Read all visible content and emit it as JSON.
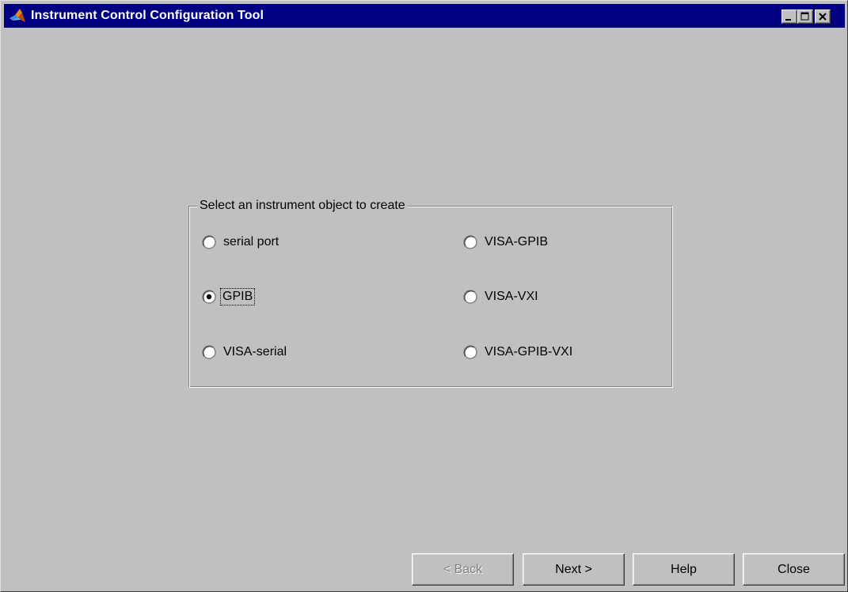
{
  "window": {
    "title": "Instrument Control Configuration Tool",
    "title_icon": "matlab-logo-icon",
    "controls": [
      "minimize-icon",
      "maximize-icon",
      "close-icon"
    ]
  },
  "group": {
    "legend": "Select an instrument object to create",
    "selected": "GPIB",
    "options": [
      {
        "label": "serial port",
        "selected": false
      },
      {
        "label": "GPIB",
        "selected": true
      },
      {
        "label": "VISA-serial",
        "selected": false
      },
      {
        "label": "VISA-GPIB",
        "selected": false
      },
      {
        "label": "VISA-VXI",
        "selected": false
      },
      {
        "label": "VISA-GPIB-VXI",
        "selected": false
      }
    ]
  },
  "buttons": {
    "back": "< Back",
    "next": "Next >",
    "help": "Help",
    "close": "Close"
  },
  "colors": {
    "titlebar": "#000080",
    "face": "#c0c0c0",
    "disabled_text": "#808080"
  }
}
